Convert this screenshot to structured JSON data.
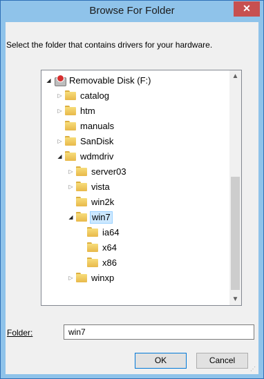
{
  "window": {
    "title": "Browse For Folder",
    "close_glyph": "✕",
    "instruction": "Select the folder that contains drivers for your hardware."
  },
  "tree": {
    "items": [
      {
        "label": "Removable Disk (F:)",
        "icon": "removable-disk-icon",
        "expander": "◢",
        "level": 0,
        "selected": false
      },
      {
        "label": "catalog",
        "icon": "folder-icon",
        "expander": "▷",
        "level": 1,
        "selected": false
      },
      {
        "label": "htm",
        "icon": "folder-icon",
        "expander": "▷",
        "level": 1,
        "selected": false
      },
      {
        "label": "manuals",
        "icon": "folder-icon",
        "expander": "",
        "level": 1,
        "selected": false
      },
      {
        "label": "SanDisk",
        "icon": "folder-icon",
        "expander": "▷",
        "level": 1,
        "selected": false
      },
      {
        "label": "wdmdriv",
        "icon": "folder-icon",
        "expander": "◢",
        "level": 1,
        "selected": false
      },
      {
        "label": "server03",
        "icon": "folder-icon",
        "expander": "▷",
        "level": 2,
        "selected": false
      },
      {
        "label": "vista",
        "icon": "folder-icon",
        "expander": "▷",
        "level": 2,
        "selected": false
      },
      {
        "label": "win2k",
        "icon": "folder-icon",
        "expander": "",
        "level": 2,
        "selected": false
      },
      {
        "label": "win7",
        "icon": "folder-icon",
        "expander": "◢",
        "level": 2,
        "selected": true
      },
      {
        "label": "ia64",
        "icon": "folder-icon",
        "expander": "",
        "level": 3,
        "selected": false
      },
      {
        "label": "x64",
        "icon": "folder-icon",
        "expander": "",
        "level": 3,
        "selected": false
      },
      {
        "label": "x86",
        "icon": "folder-icon",
        "expander": "",
        "level": 3,
        "selected": false
      },
      {
        "label": "winxp",
        "icon": "folder-icon",
        "expander": "▷",
        "level": 2,
        "selected": false
      }
    ],
    "scroll_up_glyph": "▲",
    "scroll_down_glyph": "▼"
  },
  "folder": {
    "label": "Folder:",
    "value": "win7"
  },
  "buttons": {
    "ok": "OK",
    "cancel": "Cancel"
  }
}
